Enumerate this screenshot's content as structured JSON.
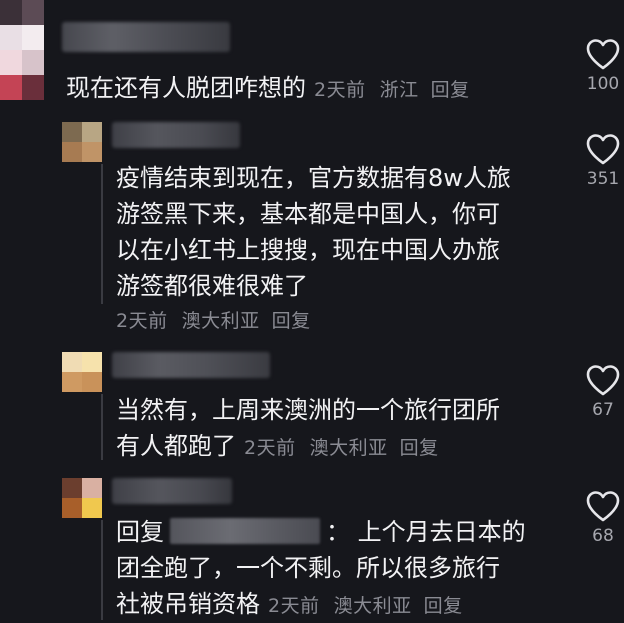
{
  "comments": [
    {
      "text": "现在还有人脱团咋想的",
      "time": "2天前",
      "location": "浙江",
      "reply_label": "回复",
      "likes": "100"
    },
    {
      "text": "疫情结束到现在，官方数据有8w人旅游签黑下来，基本都是中国人，你可以在小红书上搜搜，现在中国人办旅游签都很难很难了",
      "lines": [
        "疫情结束到现在，官方数据有8w人旅",
        "游签黑下来，基本都是中国人，你可",
        "以在小红书上搜搜，现在中国人办旅",
        "游签都很难很难了"
      ],
      "time": "2天前",
      "location": "澳大利亚",
      "reply_label": "回复",
      "likes": "351"
    },
    {
      "lines": [
        "当然有，上周来澳洲的一个旅行团所",
        "有人都跑了"
      ],
      "time": "2天前",
      "location": "澳大利亚",
      "reply_label": "回复",
      "likes": "67"
    },
    {
      "reply_prefix": "回复",
      "line1_tail": "：  上个月去日本的",
      "lines": [
        "团全跑了，一个不剩。所以很多旅行",
        "社被吊销资格"
      ],
      "time": "2天前",
      "location": "澳大利亚",
      "reply_label": "回复",
      "likes": "68"
    }
  ],
  "colors": {
    "background": "#16171c",
    "text": "#f2f2f4",
    "meta": "#8a8b93",
    "like_icon": "#e6e6ea"
  },
  "icons": [
    "heart-icon"
  ]
}
